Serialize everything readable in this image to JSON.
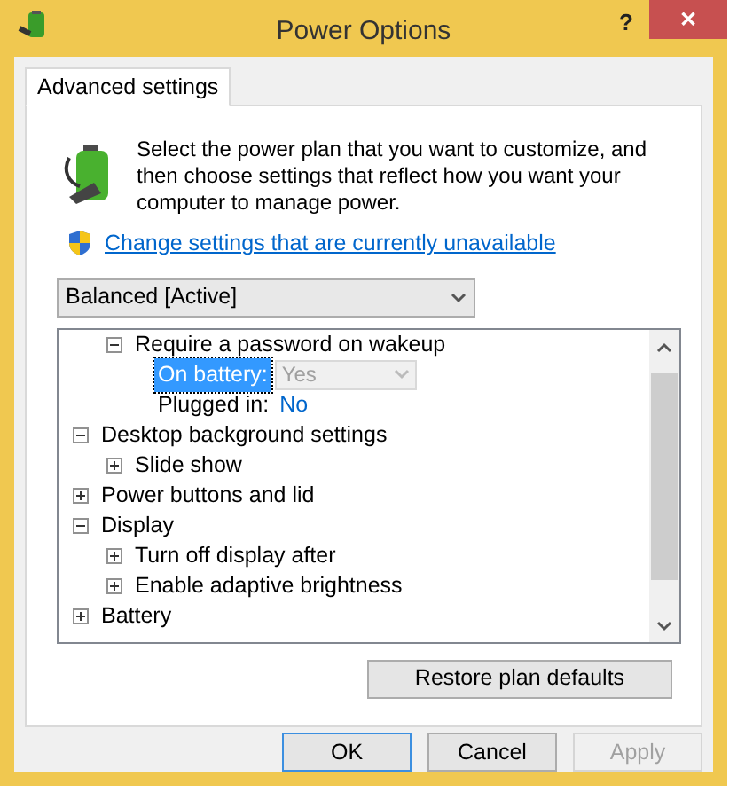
{
  "window": {
    "title": "Power Options",
    "help": "?",
    "close": "✕"
  },
  "tabs": [
    {
      "label": "Advanced settings",
      "selected": true
    }
  ],
  "intro": "Select the power plan that you want to customize, and then choose settings that reflect how you want your computer to manage power.",
  "link": "Change settings that are currently unavailable",
  "plan": {
    "value": "Balanced [Active]"
  },
  "tree": [
    {
      "kind": "continued",
      "children": [
        {
          "label": "Require a password on wakeup",
          "expanded": true,
          "settings": [
            {
              "kind": "dropdown",
              "label": "On battery:",
              "value": "Yes",
              "selected": true
            },
            {
              "kind": "link",
              "label": "Plugged in:",
              "value": "No",
              "selected": false
            }
          ]
        }
      ]
    },
    {
      "label": "Desktop background settings",
      "expanded": true,
      "children": [
        {
          "label": "Slide show",
          "expanded": false
        }
      ]
    },
    {
      "label": "Power buttons and lid",
      "expanded": false
    },
    {
      "label": "Display",
      "expanded": true,
      "children": [
        {
          "label": "Turn off display after",
          "expanded": false
        },
        {
          "label": "Enable adaptive brightness",
          "expanded": false
        }
      ]
    },
    {
      "label": "Battery",
      "expanded": false
    }
  ],
  "restore": "Restore plan defaults",
  "buttons": [
    {
      "label": "OK",
      "disabled": false,
      "selected": true
    },
    {
      "label": "Cancel",
      "disabled": false,
      "selected": false
    },
    {
      "label": "Apply",
      "disabled": true,
      "selected": false
    }
  ]
}
